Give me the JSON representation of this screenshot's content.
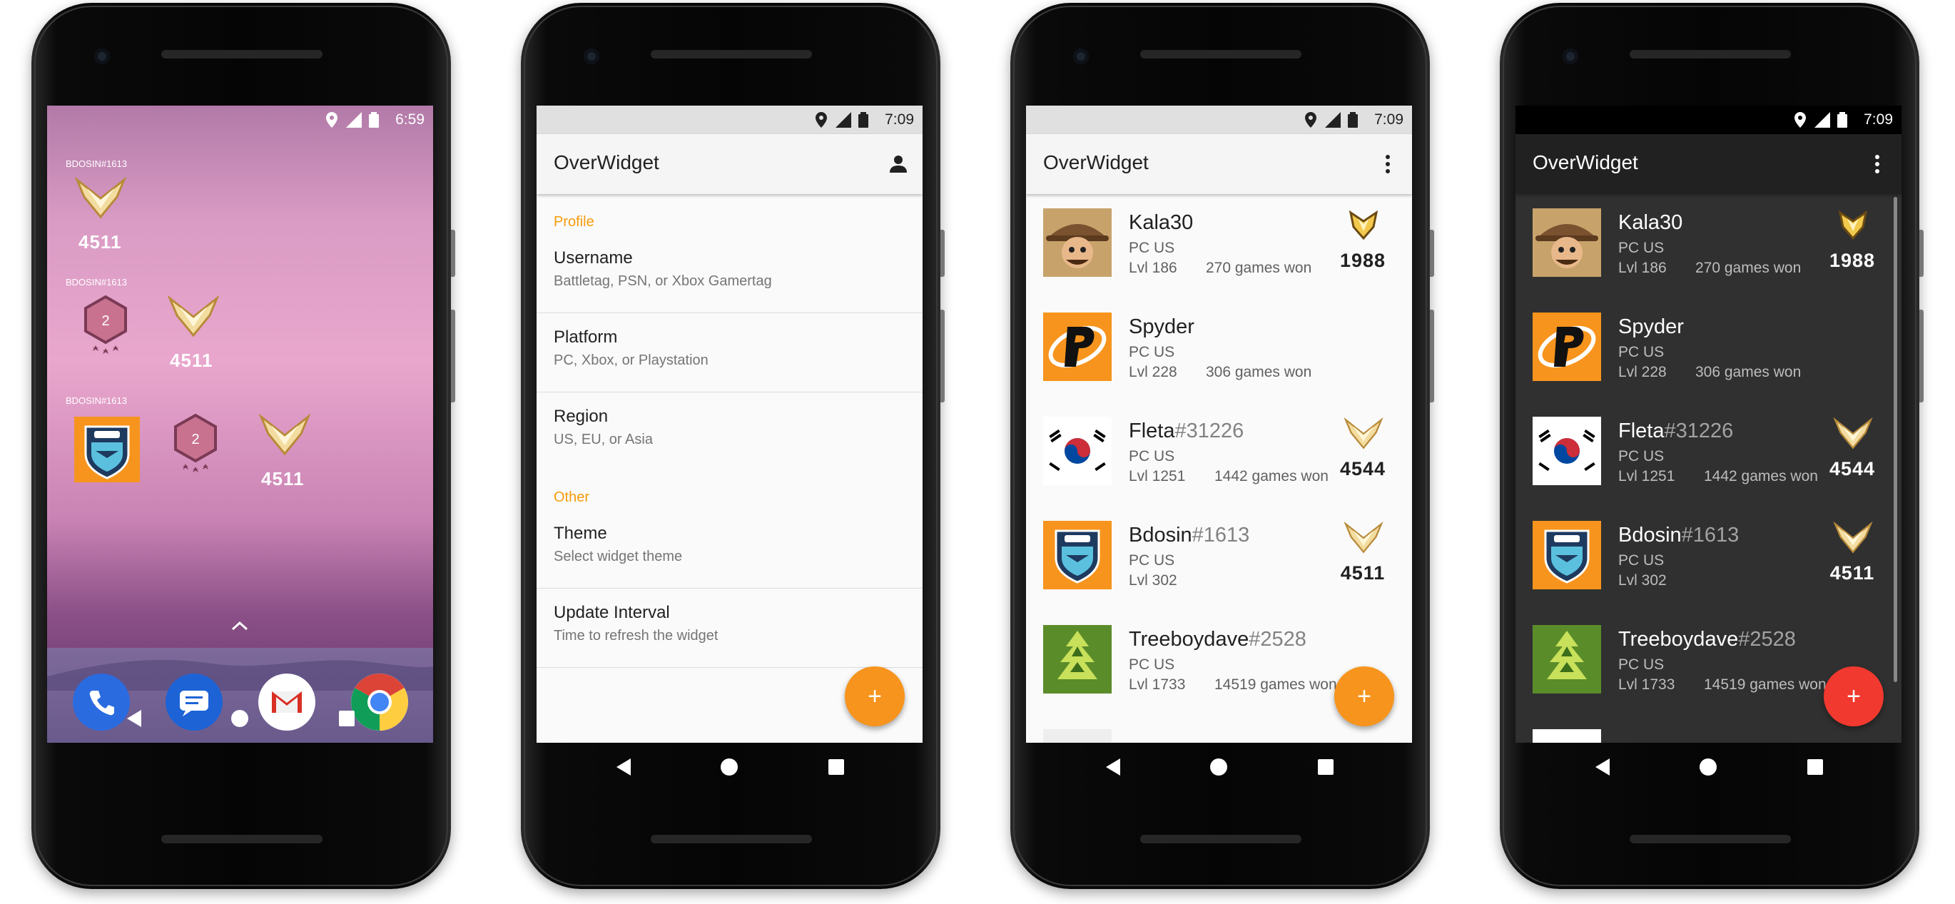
{
  "phone1": {
    "status": {
      "time": "6:59"
    },
    "widgets": [
      {
        "user": "BDOSIN#1613",
        "sr": "4511"
      },
      {
        "user": "BDOSIN#1613",
        "rank_level": "2",
        "sr": "4511"
      },
      {
        "user": "BDOSIN#1613",
        "rank_level": "2",
        "sr": "4511"
      }
    ],
    "dock_apps": [
      "phone-app-icon",
      "messages-app-icon",
      "gmail-app-icon",
      "chrome-app-icon"
    ]
  },
  "phone2": {
    "status": {
      "time": "7:09"
    },
    "app_title": "OverWidget",
    "sections": [
      {
        "header": "Profile",
        "items": [
          {
            "title": "Username",
            "subtitle": "Battletag, PSN, or Xbox Gamertag"
          },
          {
            "title": "Platform",
            "subtitle": "PC, Xbox, or Playstation"
          },
          {
            "title": "Region",
            "subtitle": "US, EU, or Asia"
          }
        ]
      },
      {
        "header": "Other",
        "items": [
          {
            "title": "Theme",
            "subtitle": "Select widget theme"
          },
          {
            "title": "Update Interval",
            "subtitle": "Time to refresh the widget"
          }
        ]
      }
    ],
    "fab": "+"
  },
  "phone3": {
    "status": {
      "time": "7:09"
    },
    "app_title": "OverWidget",
    "theme": "light",
    "fab_color": "#f7941d",
    "fab": "+"
  },
  "phone4": {
    "status": {
      "time": "7:09"
    },
    "app_title": "OverWidget",
    "theme": "dark",
    "fab_color": "#f1392f",
    "fab": "+"
  },
  "players": [
    {
      "name": "Kala30",
      "tag": "",
      "region": "PC US",
      "level": "Lvl 186",
      "games": "270 games won",
      "sr": "1988",
      "avatar": "mccree-avatar"
    },
    {
      "name": "Spyder",
      "tag": "",
      "region": "PC US",
      "level": "Lvl 228",
      "games": "306 games won",
      "sr": "",
      "avatar": "philadelphia-fusion-avatar"
    },
    {
      "name": "Fleta",
      "tag": "#31226",
      "region": "PC US",
      "level": "Lvl 1251",
      "games": "1442 games won",
      "sr": "4544",
      "avatar": "korea-flag-avatar"
    },
    {
      "name": "Bdosin",
      "tag": "#1613",
      "region": "PC US",
      "level": "Lvl 302",
      "games": "",
      "sr": "4511",
      "avatar": "london-spitfire-avatar"
    },
    {
      "name": "Treeboydave",
      "tag": "#2528",
      "region": "PC US",
      "level": "Lvl 1733",
      "games": "14519 games won",
      "sr": "",
      "avatar": "tree-emblem-avatar"
    }
  ],
  "colors": {
    "accent": "#f59c0b",
    "orange_fab": "#f7941d",
    "red_fab": "#f1392f",
    "dark_bg": "#303030",
    "dark_bar": "#212121",
    "light_bg": "#fafafa"
  }
}
